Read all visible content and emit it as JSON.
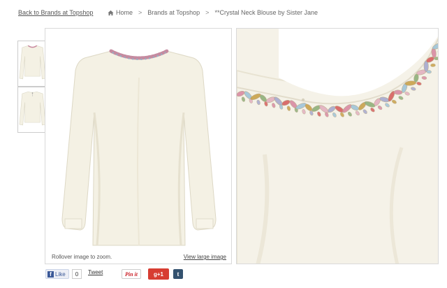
{
  "nav": {
    "back_link": "Back to Brands at Topshop",
    "breadcrumb": {
      "home": "Home",
      "separator": ">",
      "brands": "Brands at Topshop",
      "current": "**Crystal Neck Blouse by Sister Jane"
    }
  },
  "gallery": {
    "thumbnails": [
      "front view",
      "back view"
    ],
    "rollover_hint": "Rollover image to zoom.",
    "view_large_label": "View large image"
  },
  "product": {
    "blouse_color": "#f4f1e4",
    "jewel_colors": [
      "#d98aa3",
      "#9fc4d8",
      "#c9a24a",
      "#8fb07a",
      "#e3b0c0",
      "#a6a9cf",
      "#d7605f"
    ]
  },
  "social": {
    "fb_like_label": "Like",
    "fb_like_count": "0",
    "tweet_label": "Tweet",
    "pinit_label": "Pin it",
    "gplus_label": "g+1",
    "tumblr_label": "t",
    "colors": {
      "facebook": "#3b5998",
      "pinterest": "#cb2027",
      "gplus": "#d73d32",
      "tumblr": "#34526f"
    }
  }
}
